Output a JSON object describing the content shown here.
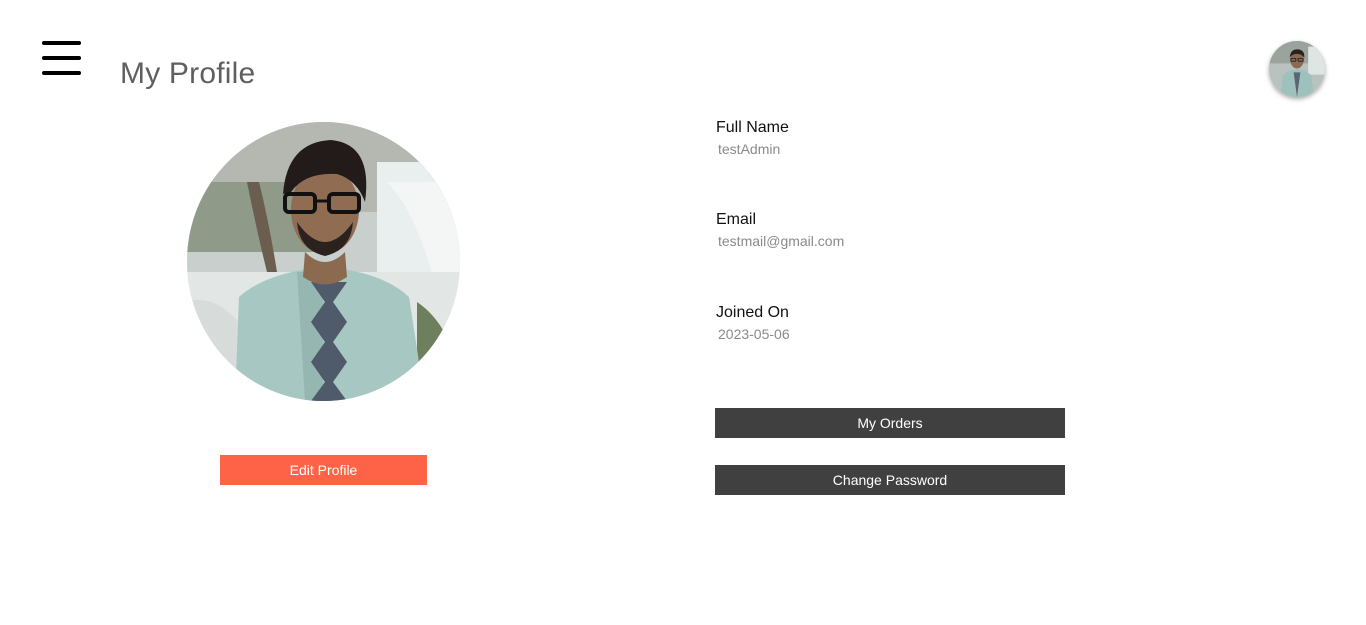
{
  "header": {
    "title": "My Profile",
    "menu_icon": "hamburger-menu-icon",
    "avatar_alt": "user-avatar"
  },
  "profile": {
    "photo_desc": "profile-photo",
    "edit_label": "Edit Profile"
  },
  "info": {
    "full_name_label": "Full Name",
    "full_name_value": "testAdmin",
    "email_label": "Email",
    "email_value": "testmail@gmail.com",
    "joined_label": "Joined On",
    "joined_value": "2023-05-06"
  },
  "actions": {
    "orders_label": "My Orders",
    "password_label": "Change Password"
  },
  "colors": {
    "accent": "#ff6347",
    "dark_button": "#404040",
    "title": "#5f5f5f"
  }
}
